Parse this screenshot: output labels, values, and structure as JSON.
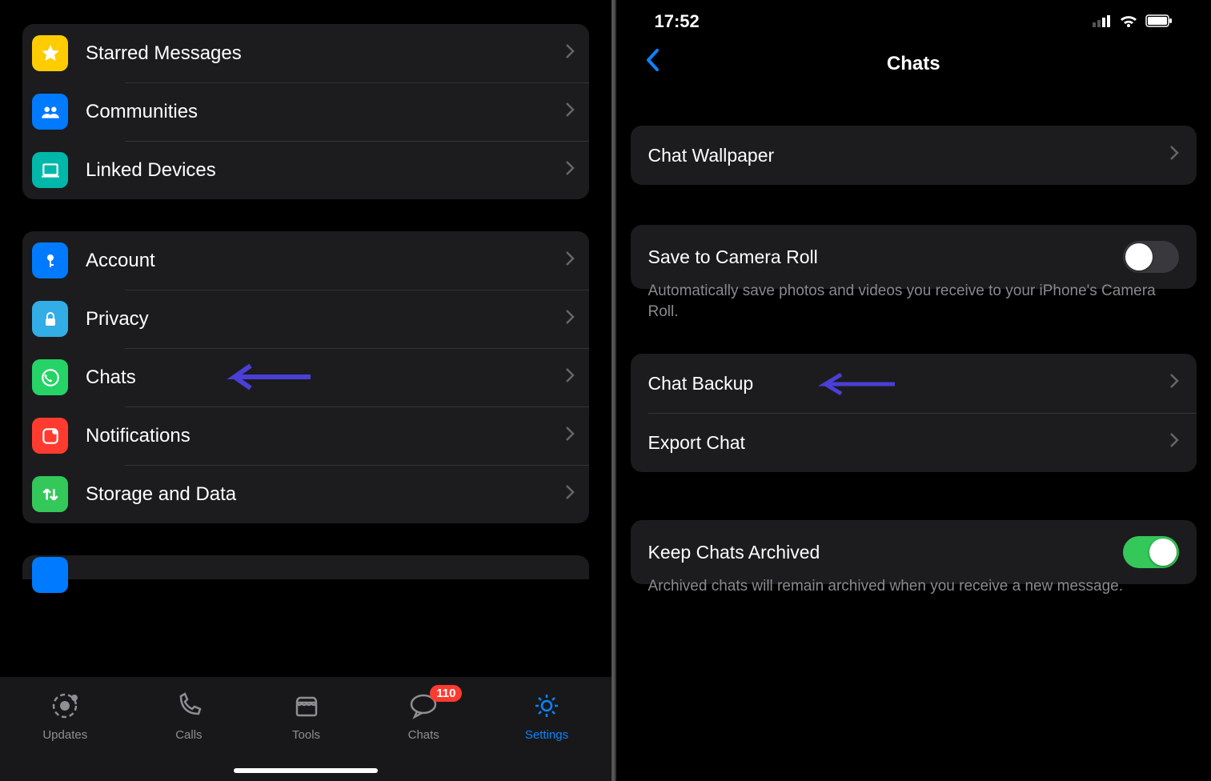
{
  "left": {
    "group1": [
      {
        "label": "Starred Messages",
        "icon": "star",
        "bg": "#ffcc00"
      },
      {
        "label": "Communities",
        "icon": "people",
        "bg": "#007aff"
      },
      {
        "label": "Linked Devices",
        "icon": "laptop",
        "bg": "#00b894"
      }
    ],
    "group2": [
      {
        "label": "Account",
        "icon": "key",
        "bg": "#007aff"
      },
      {
        "label": "Privacy",
        "icon": "lock",
        "bg": "#32ade6"
      },
      {
        "label": "Chats",
        "icon": "whatsapp",
        "bg": "#25d366"
      },
      {
        "label": "Notifications",
        "icon": "square-badge",
        "bg": "#ff3b30"
      },
      {
        "label": "Storage and Data",
        "icon": "updown",
        "bg": "#34c759"
      }
    ],
    "tabs": [
      {
        "label": "Updates",
        "icon": "status",
        "active": false
      },
      {
        "label": "Calls",
        "icon": "phone",
        "active": false
      },
      {
        "label": "Tools",
        "icon": "store",
        "active": false
      },
      {
        "label": "Chats",
        "icon": "chat",
        "active": false,
        "badge": "110"
      },
      {
        "label": "Settings",
        "icon": "gear",
        "active": true
      }
    ]
  },
  "right": {
    "status_time": "17:52",
    "title": "Chats",
    "wallpaper": {
      "label": "Chat Wallpaper"
    },
    "camera_roll": {
      "label": "Save to Camera Roll",
      "on": false,
      "footnote": "Automatically save photos and videos you receive to your iPhone's Camera Roll."
    },
    "backup_group": [
      {
        "label": "Chat Backup"
      },
      {
        "label": "Export Chat"
      }
    ],
    "archived": {
      "label": "Keep Chats Archived",
      "on": true,
      "footnote": "Archived chats will remain archived when you receive a new message."
    }
  }
}
